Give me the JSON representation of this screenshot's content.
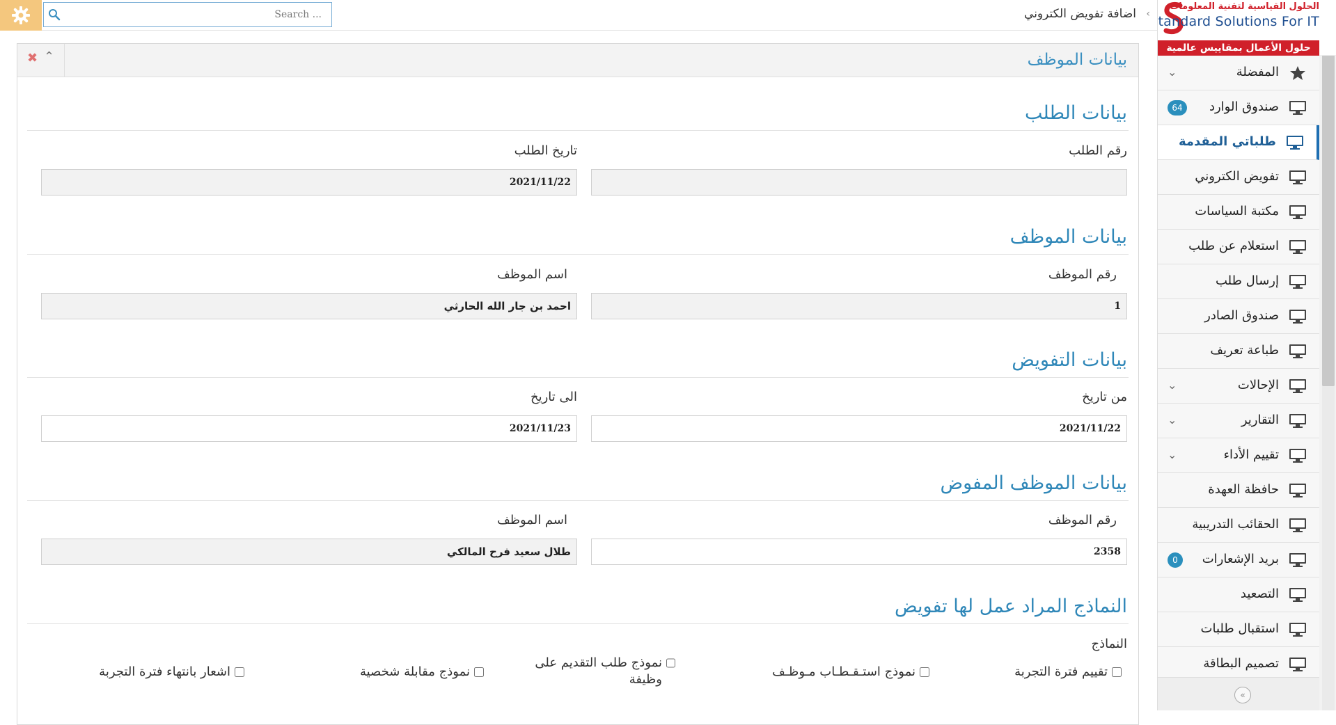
{
  "brand": {
    "arabic_name": "الحلول القياسية لتقنية المعلومات",
    "english_name": "Standard Solutions For IT",
    "tagline": "حلول الأعمال بمقاييس عالمية"
  },
  "topbar": {
    "search_placeholder": "Search ...",
    "breadcrumb": "اضافة تفويض الكتروني"
  },
  "sidebar": {
    "items": [
      {
        "label": "المفضلة",
        "icon": "star-icon",
        "chevron": true
      },
      {
        "label": "صندوق الوارد",
        "icon": "monitor-icon",
        "badge": "64"
      },
      {
        "label": "طلباتي المقدمة",
        "icon": "monitor-icon",
        "active": true
      },
      {
        "label": "تفويض الكتروني",
        "icon": "monitor-icon"
      },
      {
        "label": "مكتبة السياسات",
        "icon": "monitor-icon"
      },
      {
        "label": "استعلام عن طلب",
        "icon": "monitor-icon"
      },
      {
        "label": "إرسال طلب",
        "icon": "monitor-icon"
      },
      {
        "label": "صندوق الصادر",
        "icon": "monitor-icon"
      },
      {
        "label": "طباعة تعريف",
        "icon": "monitor-icon"
      },
      {
        "label": "الإحالات",
        "icon": "monitor-icon",
        "chevron": true
      },
      {
        "label": "التقارير",
        "icon": "monitor-icon",
        "chevron": true
      },
      {
        "label": "تقييم الأداء",
        "icon": "monitor-icon",
        "chevron": true
      },
      {
        "label": "حافظة العهدة",
        "icon": "monitor-icon"
      },
      {
        "label": "الحقائب التدريبية",
        "icon": "monitor-icon"
      },
      {
        "label": "بريد الإشعارات",
        "icon": "monitor-icon",
        "badge": "0"
      },
      {
        "label": "التصعيد",
        "icon": "monitor-icon"
      },
      {
        "label": "استقبال طلبات",
        "icon": "monitor-icon"
      },
      {
        "label": "تصميم البطاقة",
        "icon": "monitor-icon"
      }
    ]
  },
  "panel": {
    "title": "بيانات الموظف",
    "request_section": {
      "title": "بيانات الطلب",
      "request_no_label": "رقم الطلب",
      "request_no_value": "",
      "request_date_label": "تاريخ الطلب",
      "request_date_value": "2021/11/22"
    },
    "employee_section": {
      "title": "بيانات الموظف",
      "emp_no_label": "رقم الموظف",
      "emp_no_value": "1",
      "emp_name_label": "اسم الموظف",
      "emp_name_value": "احمد بن جار الله الحارثي"
    },
    "delegation_section": {
      "title": "بيانات التفويض",
      "from_label": "من تاريخ",
      "from_value": "2021/11/22",
      "to_label": "الى تاريخ",
      "to_value": "2021/11/23"
    },
    "delegate_section": {
      "title": "بيانات الموظف المفوض",
      "emp_no_label": "رقم الموظف",
      "emp_no_value": "2358",
      "emp_name_label": "اسم الموظف",
      "emp_name_value": "طلال سعيد فرح المالكي"
    },
    "forms_section": {
      "title": "النماذج المراد عمل لها تفويض",
      "forms_label": "النماذج",
      "forms": [
        "تقييم فترة التجربة",
        "نموذج استـقـطـاب مـوظـف",
        "نموذج طلب التقديم على وظيفة",
        "نموذج مقابلة شخصية",
        "اشعار بانتهاء فترة التجربة"
      ]
    }
  }
}
